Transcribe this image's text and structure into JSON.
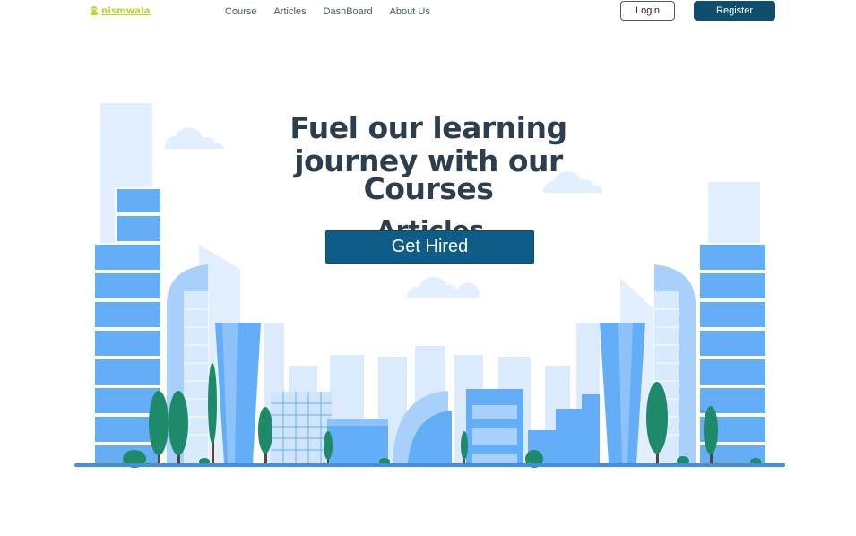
{
  "brand": {
    "name": "nismwala",
    "color": "#b9d42a"
  },
  "nav": {
    "links": [
      "Course",
      "Articles",
      "DashBoard",
      "About Us"
    ],
    "login_label": "Login",
    "register_label": "Register"
  },
  "hero": {
    "headline_line1": "Fuel our learning",
    "headline_line2": "journey with our",
    "headline_line3": "Courses",
    "rotating_word_next": "Articles",
    "cta_label": "Get Hired"
  },
  "colors": {
    "accent": "#0e5d88",
    "register_bg": "#0e4d6b",
    "building": "#64aef8",
    "tree": "#1f8a6a"
  },
  "icons": {
    "logo": "logo-mark-icon"
  }
}
